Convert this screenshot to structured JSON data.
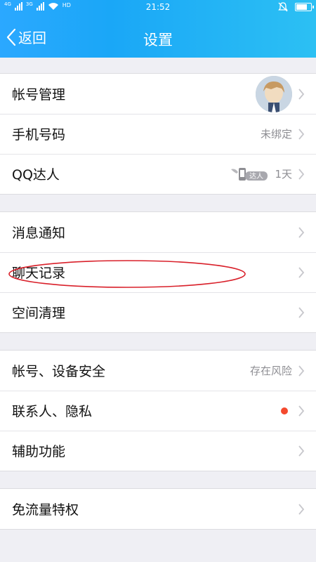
{
  "status_bar": {
    "left": [
      "4G",
      "3G",
      "HD"
    ],
    "time": "21:52"
  },
  "header": {
    "back_label": "返回",
    "title": "设置"
  },
  "groups": [
    {
      "items": [
        {
          "label": "帐号管理",
          "right_text": "",
          "extra": "avatar"
        },
        {
          "label": "手机号码",
          "right_text": "未绑定"
        },
        {
          "label": "QQ达人",
          "right_text": "1天",
          "badge": "达人"
        }
      ]
    },
    {
      "items": [
        {
          "label": "消息通知",
          "right_text": ""
        },
        {
          "label": "聊天记录",
          "right_text": ""
        },
        {
          "label": "空间清理",
          "right_text": ""
        }
      ]
    },
    {
      "items": [
        {
          "label": "帐号、设备安全",
          "right_text": "存在风险"
        },
        {
          "label": "联系人、隐私",
          "right_text": "",
          "extra": "red-dot"
        },
        {
          "label": "辅助功能",
          "right_text": ""
        }
      ]
    },
    {
      "items": [
        {
          "label": "免流量特权",
          "right_text": ""
        }
      ]
    }
  ],
  "colors": {
    "header_start": "#2ba8ff",
    "header_end": "#2cc0f3",
    "page_bg": "#efeff4",
    "red_dot": "#f4492e",
    "annotation_ellipse": "#d9202a"
  }
}
